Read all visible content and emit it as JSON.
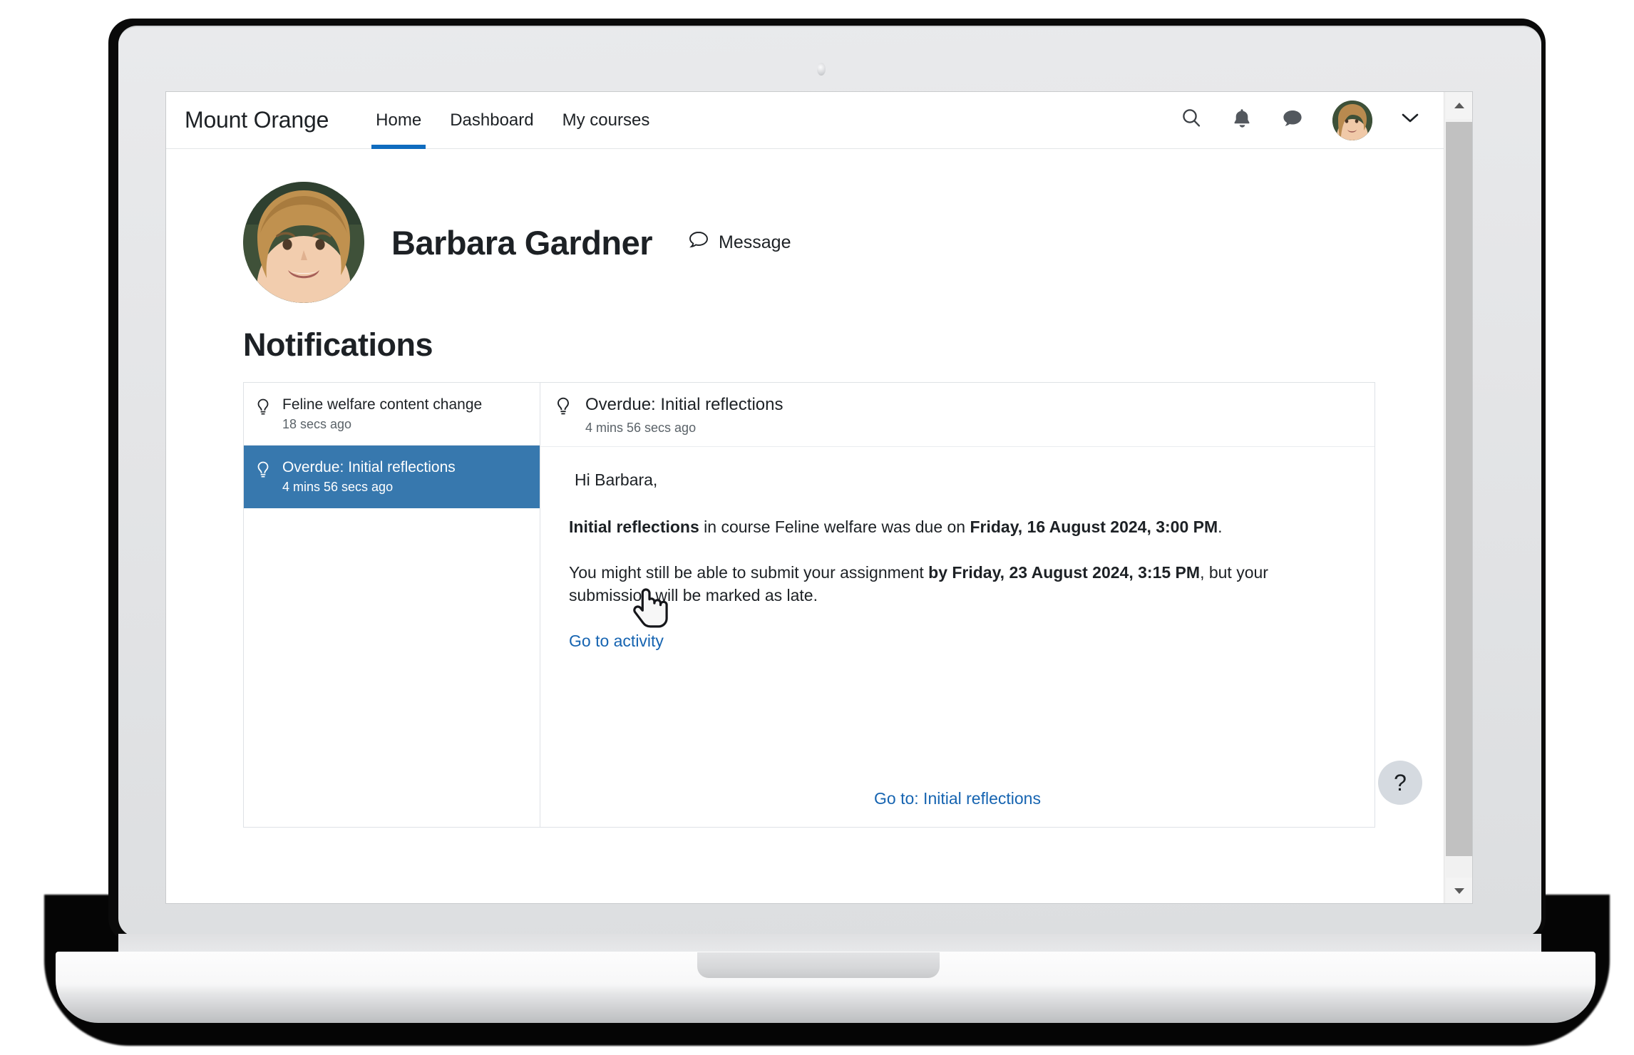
{
  "navbar": {
    "brand": "Mount Orange",
    "items": [
      {
        "label": "Home",
        "active": true
      },
      {
        "label": "Dashboard",
        "active": false
      },
      {
        "label": "My courses",
        "active": false
      }
    ],
    "icons": [
      "search-icon",
      "notification-bell-icon",
      "messages-icon",
      "user-avatar",
      "chevron-down-icon"
    ],
    "accent_color": "#0f6cbf"
  },
  "profile": {
    "name": "Barbara Gardner",
    "message_label": "Message",
    "message_icon": "speech-bubble-icon"
  },
  "page": {
    "title": "Notifications"
  },
  "notifications": {
    "items": [
      {
        "subject": "Feline welfare content change",
        "time": "18 secs ago",
        "icon": "lightbulb-icon",
        "selected": false
      },
      {
        "subject": "Overdue: Initial reflections",
        "time": "4 mins 56 secs ago",
        "icon": "lightbulb-icon",
        "selected": true
      }
    ],
    "selected_color": "#3778ae"
  },
  "detail": {
    "icon": "lightbulb-icon",
    "title": "Overdue: Initial reflections",
    "time": "4 mins 56 secs ago",
    "greeting": "Hi Barbara,",
    "line1": {
      "bold_activity": "Initial reflections",
      "mid": " in course Feline welfare was due on ",
      "bold_due": "Friday, 16 August 2024, 3:00 PM",
      "end": "."
    },
    "line2": {
      "start": "You might still be able to submit your assignment ",
      "bold_cutoff": "by Friday, 23 August 2024, 3:15 PM",
      "end": ", but your submission will be marked as late."
    },
    "activity_link": "Go to activity",
    "footer_link": "Go to: Initial reflections",
    "link_color": "#1664b1"
  },
  "help": {
    "label": "?"
  },
  "scrollbar": {
    "up_arrow": "scroll-up-arrow",
    "down_arrow": "scroll-down-arrow"
  }
}
